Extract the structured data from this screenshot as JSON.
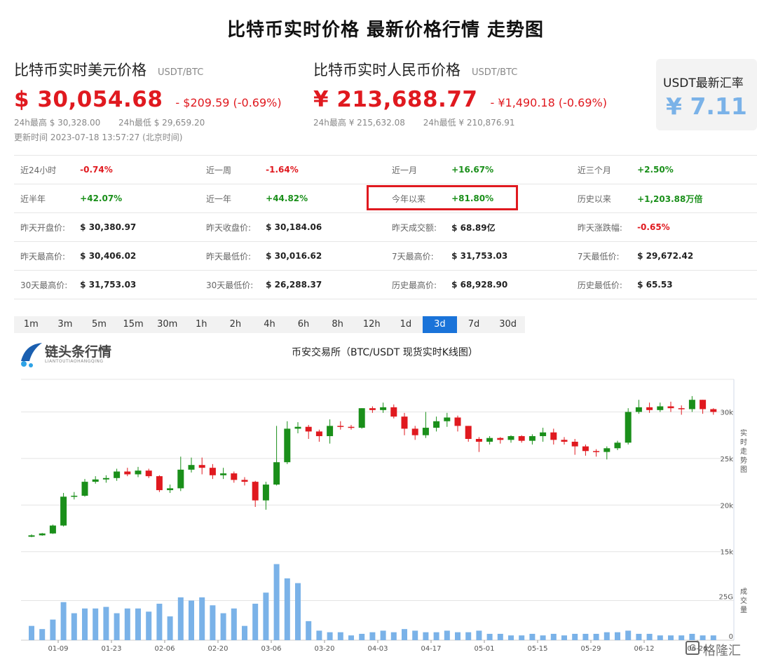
{
  "page": {
    "title": "比特币实时价格 最新价格行情 走势图"
  },
  "usd": {
    "title": "比特币实时美元价格",
    "pair": "USDT/BTC",
    "price": "$ 30,054.68",
    "change": "- $209.59 (-0.69%)",
    "high": "24h最高  $ 30,328.00",
    "low": "24h最低  $ 29,659.20",
    "updated": "更新时间  2023-07-18 13:57:27  (北京时间)"
  },
  "cny": {
    "title": "比特币实时人民币价格",
    "pair": "USDT/BTC",
    "price": "¥ 213,688.77",
    "change": "- ¥1,490.18  (-0.69%)",
    "high": "24h最高  ¥ 215,632.08",
    "low": "24h最低  ¥ 210,876.91"
  },
  "rate": {
    "label": "USDT最新汇率",
    "value": "¥ 7.11"
  },
  "colors": {
    "up": "#1a8f1a",
    "down": "#e0191f",
    "volume": "#7ab2e8",
    "accent": "#1a73d9"
  },
  "stats": [
    [
      {
        "label": "近24小时",
        "value": "-0.74%",
        "trend": "down"
      },
      {
        "label": "近一周",
        "value": "-1.64%",
        "trend": "down"
      },
      {
        "label": "近一月",
        "value": "+16.67%",
        "trend": "up"
      },
      {
        "label": "近三个月",
        "value": "+2.50%",
        "trend": "up"
      }
    ],
    [
      {
        "label": "近半年",
        "value": "+42.07%",
        "trend": "up"
      },
      {
        "label": "近一年",
        "value": "+44.82%",
        "trend": "up"
      },
      {
        "label": "今年以来",
        "value": "+81.80%",
        "trend": "up"
      },
      {
        "label": "历史以来",
        "value": "+1,203.88万倍",
        "trend": "up"
      }
    ],
    [
      {
        "label": "昨天开盘价:",
        "value": "$ 30,380.97",
        "trend": "plain"
      },
      {
        "label": "昨天收盘价:",
        "value": "$ 30,184.06",
        "trend": "plain"
      },
      {
        "label": "昨天成交额:",
        "value": "$ 68.89亿",
        "trend": "plain"
      },
      {
        "label": "昨天涨跌幅:",
        "value": "-0.65%",
        "trend": "down"
      }
    ],
    [
      {
        "label": "昨天最高价:",
        "value": "$ 30,406.02",
        "trend": "plain"
      },
      {
        "label": "昨天最低价:",
        "value": "$ 30,016.62",
        "trend": "plain"
      },
      {
        "label": "7天最高价:",
        "value": "$ 31,753.03",
        "trend": "plain"
      },
      {
        "label": "7天最低价:",
        "value": "$ 29,672.42",
        "trend": "plain"
      }
    ],
    [
      {
        "label": "30天最高价:",
        "value": "$ 31,753.03",
        "trend": "plain"
      },
      {
        "label": "30天最低价:",
        "value": "$ 26,288.37",
        "trend": "plain"
      },
      {
        "label": "历史最高价:",
        "value": "$ 68,928.90",
        "trend": "plain"
      },
      {
        "label": "历史最低价:",
        "value": "$ 65.53",
        "trend": "plain"
      }
    ]
  ],
  "highlighted_stat": "今年以来",
  "timeframes": [
    "1m",
    "3m",
    "5m",
    "15m",
    "30m",
    "1h",
    "2h",
    "4h",
    "6h",
    "8h",
    "12h",
    "1d",
    "3d",
    "7d",
    "30d"
  ],
  "active_timeframe": "3d",
  "logo": {
    "text": "链头条行情",
    "sub": "LIANTOUTIAOHANGQING"
  },
  "watermark": "格隆汇",
  "chart_data": {
    "type": "candlestick",
    "title": "币安交易所（BTC/USDT 现货实时K线图）",
    "price_axis_label": "实时走势图",
    "volume_axis_label": "成交量",
    "y_ticks": [
      "30k",
      "25k",
      "20k",
      "15k"
    ],
    "y_tick_values": [
      30000,
      25000,
      20000,
      15000
    ],
    "ylim": [
      14000,
      33500
    ],
    "volume_ticks": [
      "25G",
      "0"
    ],
    "volume_tick_values": [
      25,
      0
    ],
    "volume_lim": [
      0,
      50
    ],
    "x_ticks": [
      "01-09",
      "01-23",
      "02-06",
      "02-20",
      "03-06",
      "03-20",
      "04-03",
      "04-17",
      "05-01",
      "05-15",
      "05-29",
      "06-12",
      "06-26"
    ],
    "x_tick_indices": [
      2,
      7,
      12,
      17,
      22,
      27,
      32,
      37,
      42,
      47,
      52,
      57,
      62
    ],
    "candles": [
      [
        16600,
        16750,
        16550,
        16850,
        9
      ],
      [
        16750,
        16950,
        16700,
        17000,
        7
      ],
      [
        16950,
        17800,
        16900,
        17900,
        13
      ],
      [
        17800,
        20900,
        17700,
        21300,
        24
      ],
      [
        20900,
        21000,
        20600,
        21400,
        17
      ],
      [
        21000,
        22500,
        20900,
        22800,
        20
      ],
      [
        22500,
        22750,
        22300,
        23100,
        20
      ],
      [
        22750,
        22900,
        22400,
        23200,
        21
      ],
      [
        22900,
        23600,
        22600,
        23900,
        17
      ],
      [
        23600,
        23300,
        23100,
        24000,
        20
      ],
      [
        23300,
        23700,
        23000,
        24100,
        20
      ],
      [
        23700,
        23100,
        22900,
        23900,
        18
      ],
      [
        23100,
        21600,
        21400,
        23200,
        23
      ],
      [
        21600,
        21800,
        21300,
        22200,
        15
      ],
      [
        21800,
        23800,
        21500,
        25200,
        27
      ],
      [
        23800,
        24300,
        23500,
        25100,
        25
      ],
      [
        24300,
        24000,
        23300,
        25100,
        27
      ],
      [
        24000,
        23200,
        22800,
        24400,
        22
      ],
      [
        23200,
        23400,
        22800,
        24000,
        17
      ],
      [
        23400,
        22700,
        22400,
        23600,
        20
      ],
      [
        22700,
        22500,
        22100,
        23000,
        9
      ],
      [
        22500,
        20500,
        19800,
        22600,
        23
      ],
      [
        20500,
        22200,
        19500,
        22500,
        30
      ],
      [
        22200,
        24600,
        22100,
        28500,
        48
      ],
      [
        24600,
        28200,
        24400,
        29000,
        39
      ],
      [
        28200,
        28400,
        27700,
        28900,
        36
      ],
      [
        28400,
        27900,
        27100,
        28600,
        12
      ],
      [
        27900,
        27400,
        26800,
        28100,
        6
      ],
      [
        27400,
        28500,
        26600,
        29200,
        5
      ],
      [
        28500,
        28400,
        28100,
        29000,
        5
      ],
      [
        28400,
        28300,
        28100,
        28600,
        3
      ],
      [
        28300,
        30400,
        28200,
        30400,
        4
      ],
      [
        30400,
        30200,
        29900,
        30600,
        5
      ],
      [
        30200,
        30500,
        29900,
        31000,
        6
      ],
      [
        30500,
        29500,
        29300,
        30800,
        5
      ],
      [
        29500,
        28200,
        27500,
        29900,
        7
      ],
      [
        28200,
        27500,
        27000,
        28500,
        6
      ],
      [
        27500,
        28300,
        27200,
        30000,
        5
      ],
      [
        28300,
        29000,
        27900,
        29500,
        5
      ],
      [
        29000,
        29400,
        28400,
        29900,
        6
      ],
      [
        29400,
        28500,
        27900,
        29600,
        5
      ],
      [
        28500,
        27100,
        26800,
        28500,
        5
      ],
      [
        27100,
        26800,
        25700,
        27300,
        6
      ],
      [
        26800,
        27200,
        26500,
        27400,
        4
      ],
      [
        27200,
        27000,
        26600,
        27300,
        4
      ],
      [
        27000,
        27400,
        26700,
        27500,
        3
      ],
      [
        27400,
        26900,
        26700,
        27500,
        3
      ],
      [
        26900,
        27400,
        26500,
        27600,
        4
      ],
      [
        27400,
        27800,
        26800,
        28300,
        3
      ],
      [
        27800,
        27000,
        26500,
        28200,
        4
      ],
      [
        27000,
        26800,
        26500,
        27300,
        3
      ],
      [
        26800,
        26300,
        25400,
        27100,
        4
      ],
      [
        26300,
        25800,
        25300,
        26500,
        4
      ],
      [
        25800,
        25700,
        25200,
        26000,
        4
      ],
      [
        25700,
        26100,
        24900,
        26300,
        5
      ],
      [
        26100,
        26700,
        25900,
        26900,
        5
      ],
      [
        26700,
        30000,
        26500,
        30400,
        6
      ],
      [
        30000,
        30500,
        29800,
        31300,
        4
      ],
      [
        30500,
        30200,
        29900,
        31000,
        4
      ],
      [
        30200,
        30600,
        30000,
        31000,
        3
      ],
      [
        30600,
        30400,
        30000,
        31100,
        3
      ],
      [
        30400,
        30300,
        29700,
        30700,
        3
      ],
      [
        30300,
        31300,
        30000,
        31700,
        4
      ],
      [
        31300,
        30300,
        29800,
        31300,
        3
      ],
      [
        30300,
        30000,
        29700,
        30400,
        3
      ]
    ]
  }
}
